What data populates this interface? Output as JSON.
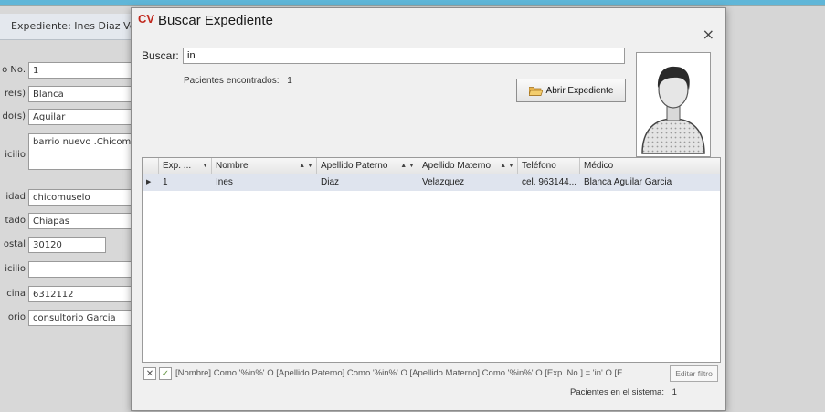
{
  "background_form": {
    "window_title": "Expediente: Ines Diaz Vela",
    "fields": [
      {
        "label": "o No.",
        "value": "1"
      },
      {
        "label": "re(s)",
        "value": "Blanca"
      },
      {
        "label": "do(s)",
        "value": "Aguilar"
      },
      {
        "label": "icilio",
        "value": "barrio nuevo .Chicomu"
      },
      {
        "label": "idad",
        "value": "chicomuselo"
      },
      {
        "label": "tado",
        "value": "Chiapas"
      },
      {
        "label": "ostal",
        "value": "30120"
      },
      {
        "label": "icilio",
        "value": ""
      },
      {
        "label": "cina",
        "value": "6312112"
      },
      {
        "label": "orio",
        "value": "consultorio Garcia"
      }
    ]
  },
  "dialog": {
    "logo": "CV",
    "title": "Buscar Expediente",
    "close": "×",
    "search_label": "Buscar:",
    "search_value": "in",
    "found_label": "Pacientes encontrados:",
    "found_count": "1",
    "open_button": "Abrir Expediente",
    "grid": {
      "columns": [
        "Exp. ...",
        "Nombre",
        "Apellido Paterno",
        "Apellido Materno",
        "Teléfono",
        "Médico"
      ],
      "rows": [
        {
          "indicator": "▶",
          "exp": "1",
          "nombre": "Ines",
          "paterno": "Diaz",
          "materno": "Velazquez",
          "telefono": "cel. 963144...",
          "medico": "Blanca Aguilar Garcia"
        }
      ]
    },
    "filter_text": "[Nombre] Como '%in%' O [Apellido Paterno] Como '%in%' O [Apellido Materno] Como '%in%' O [Exp. No.] = 'in' O [E...",
    "edit_filter": "Editar filtro",
    "system_label": "Pacientes en el sistema:",
    "system_count": "1"
  }
}
